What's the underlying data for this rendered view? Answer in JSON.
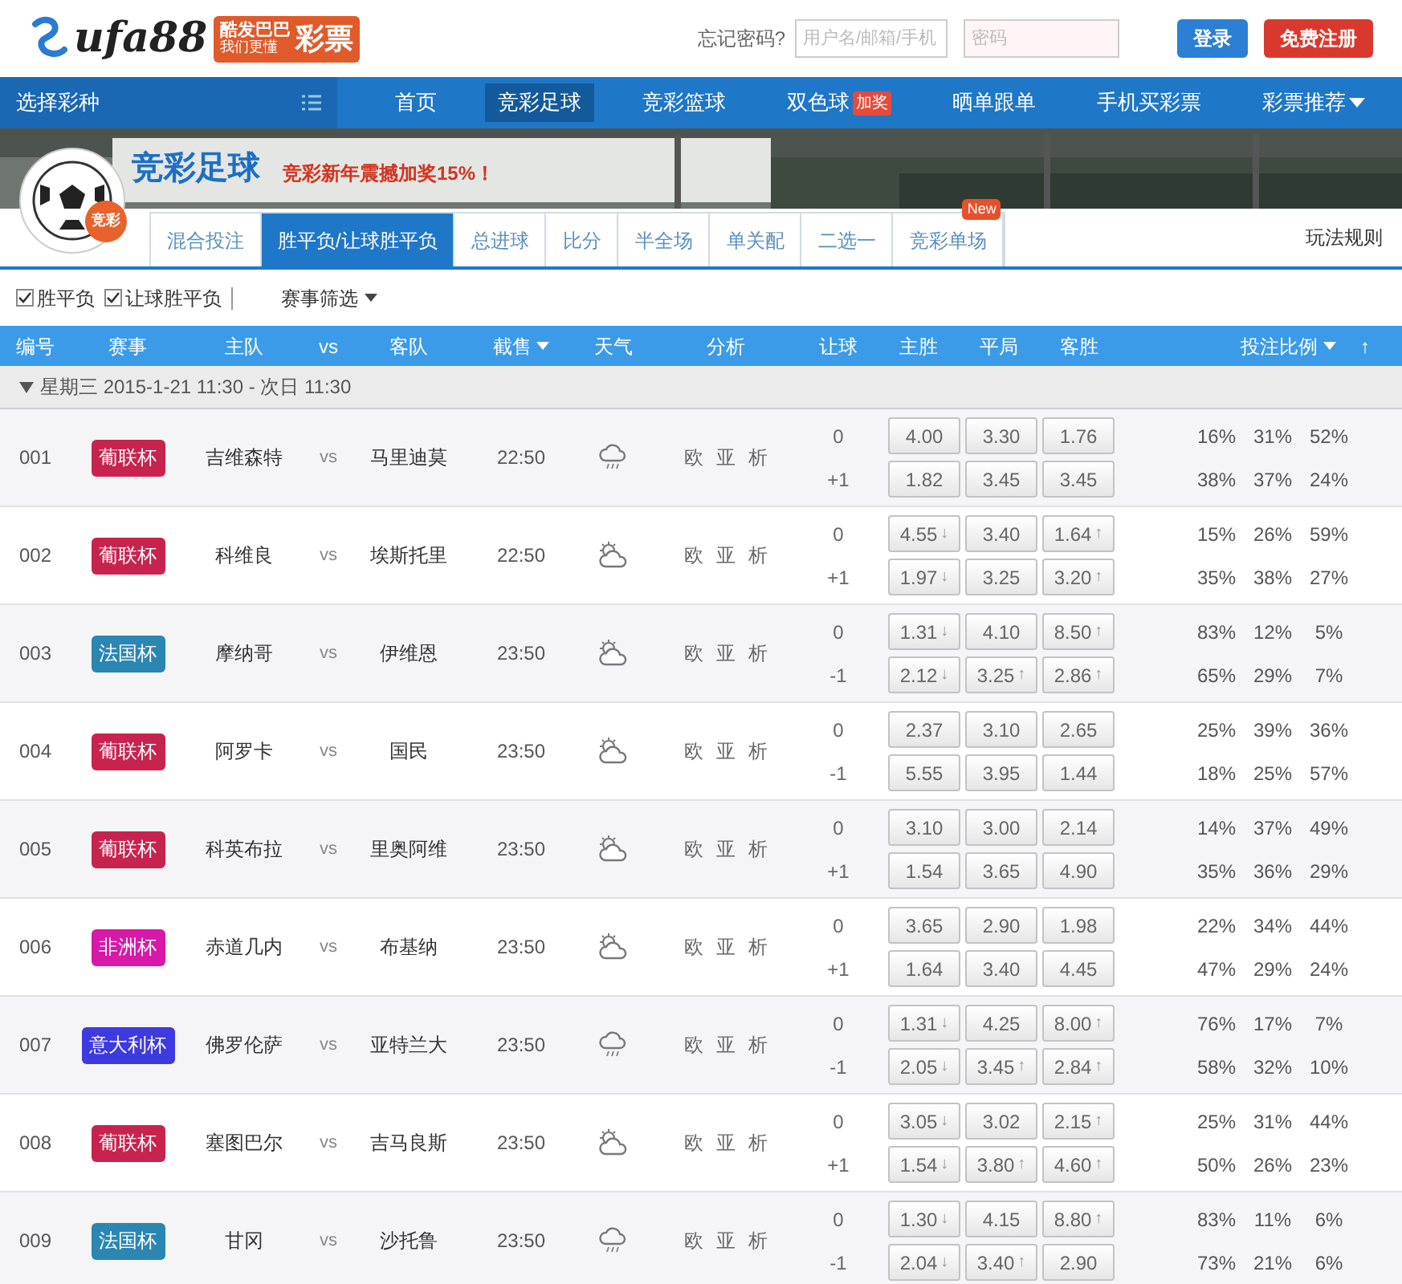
{
  "header": {
    "logo": {
      "brand": "ufa88",
      "slogan_1": "酷发巴巴",
      "slogan_2": "我们更懂",
      "slogan_3": "彩票"
    },
    "forgot": "忘记密码?",
    "username": {
      "placeholder": "用户名/邮箱/手机"
    },
    "password": {
      "placeholder": "密码"
    },
    "login": "登录",
    "register": "免费注册"
  },
  "nav": {
    "picker": "选择彩种",
    "items": [
      {
        "label": "首页",
        "selected": false
      },
      {
        "label": "竞彩足球",
        "selected": true
      },
      {
        "label": "竞彩篮球",
        "selected": false
      },
      {
        "label": "双色球",
        "selected": false,
        "badge": "加奖"
      },
      {
        "label": "晒单跟单",
        "selected": false
      },
      {
        "label": "手机买彩票",
        "selected": false
      },
      {
        "label": "彩票推荐",
        "selected": false,
        "dropdown": true
      }
    ]
  },
  "banner": {
    "title": "竞彩足球",
    "promo": "竞彩新年震撼加奖15%！",
    "emblem": "竞彩"
  },
  "tabs": [
    {
      "label": "混合投注",
      "selected": false
    },
    {
      "label": "胜平负/让球胜平负",
      "selected": true
    },
    {
      "label": "总进球",
      "selected": false
    },
    {
      "label": "比分",
      "selected": false
    },
    {
      "label": "半全场",
      "selected": false
    },
    {
      "label": "单关配",
      "selected": false
    },
    {
      "label": "二选一",
      "selected": false
    },
    {
      "label": "竞彩单场",
      "selected": false,
      "badge": "New"
    }
  ],
  "rules_link": "玩法规则",
  "filters": [
    {
      "label": "胜平负",
      "checked": true
    },
    {
      "label": "让球胜平负",
      "checked": true
    }
  ],
  "match_filter": "赛事筛选",
  "table": {
    "columns": [
      {
        "label": "编号",
        "sortable": false
      },
      {
        "label": "赛事",
        "sortable": false
      },
      {
        "label": "主队",
        "sortable": false
      },
      {
        "label": "vs",
        "sortable": false
      },
      {
        "label": "客队",
        "sortable": false
      },
      {
        "label": "截售",
        "sortable": true
      },
      {
        "label": "天气",
        "sortable": false
      },
      {
        "label": "分析",
        "sortable": false
      },
      {
        "label": "让球",
        "sortable": false
      },
      {
        "label": "主胜",
        "sortable": false
      },
      {
        "label": "平局",
        "sortable": false
      },
      {
        "label": "客胜",
        "sortable": false
      },
      {
        "label": "投注比例",
        "sortable": true
      }
    ],
    "top": "↑",
    "group": "星期三 2015-1-21 11:30 - 次日 11:30",
    "rows": [
      {
        "no": "001",
        "league": "葡联杯",
        "color": "#c8234e",
        "home": "吉维森特",
        "vs": "vs",
        "away": "马里迪莫",
        "time": "22:50",
        "weather": {
          "kind": "rain"
        },
        "links": [
          "欧",
          "亚",
          "析"
        ],
        "lines": [
          {
            "handicap": "0",
            "odds": [
              {
                "value": "4.00"
              },
              {
                "value": "3.30"
              },
              {
                "value": "1.76"
              }
            ],
            "pct": [
              "16%",
              "31%",
              "52%"
            ]
          },
          {
            "handicap": "+1",
            "odds": [
              {
                "value": "1.82"
              },
              {
                "value": "3.45"
              },
              {
                "value": "3.45"
              }
            ],
            "pct": [
              "38%",
              "37%",
              "24%"
            ]
          }
        ]
      },
      {
        "no": "002",
        "league": "葡联杯",
        "color": "#c8234e",
        "home": "科维良",
        "vs": "vs",
        "away": "埃斯托里",
        "time": "22:50",
        "weather": {
          "kind": "partly_cloudy"
        },
        "links": [
          "欧",
          "亚",
          "析"
        ],
        "lines": [
          {
            "handicap": "0",
            "odds": [
              {
                "value": "4.55",
                "arrow": "↓"
              },
              {
                "value": "3.40"
              },
              {
                "value": "1.64",
                "arrow": "↑"
              }
            ],
            "pct": [
              "15%",
              "26%",
              "59%"
            ]
          },
          {
            "handicap": "+1",
            "odds": [
              {
                "value": "1.97",
                "arrow": "↓"
              },
              {
                "value": "3.25"
              },
              {
                "value": "3.20",
                "arrow": "↑"
              }
            ],
            "pct": [
              "35%",
              "38%",
              "27%"
            ]
          }
        ]
      },
      {
        "no": "003",
        "league": "法国杯",
        "color": "#2b86b3",
        "home": "摩纳哥",
        "vs": "vs",
        "away": "伊维恩",
        "time": "23:50",
        "weather": {
          "kind": "partly_cloudy"
        },
        "links": [
          "欧",
          "亚",
          "析"
        ],
        "lines": [
          {
            "handicap": "0",
            "odds": [
              {
                "value": "1.31",
                "arrow": "↓"
              },
              {
                "value": "4.10"
              },
              {
                "value": "8.50",
                "arrow": "↑"
              }
            ],
            "pct": [
              "83%",
              "12%",
              "5%"
            ]
          },
          {
            "handicap": "-1",
            "odds": [
              {
                "value": "2.12",
                "arrow": "↓"
              },
              {
                "value": "3.25",
                "arrow": "↑"
              },
              {
                "value": "2.86",
                "arrow": "↑"
              }
            ],
            "pct": [
              "65%",
              "29%",
              "7%"
            ]
          }
        ]
      },
      {
        "no": "004",
        "league": "葡联杯",
        "color": "#c8234e",
        "home": "阿罗卡",
        "vs": "vs",
        "away": "国民",
        "time": "23:50",
        "weather": {
          "kind": "partly_cloudy"
        },
        "links": [
          "欧",
          "亚",
          "析"
        ],
        "lines": [
          {
            "handicap": "0",
            "odds": [
              {
                "value": "2.37"
              },
              {
                "value": "3.10"
              },
              {
                "value": "2.65"
              }
            ],
            "pct": [
              "25%",
              "39%",
              "36%"
            ]
          },
          {
            "handicap": "-1",
            "odds": [
              {
                "value": "5.55"
              },
              {
                "value": "3.95"
              },
              {
                "value": "1.44"
              }
            ],
            "pct": [
              "18%",
              "25%",
              "57%"
            ]
          }
        ]
      },
      {
        "no": "005",
        "league": "葡联杯",
        "color": "#c8234e",
        "home": "科英布拉",
        "vs": "vs",
        "away": "里奥阿维",
        "time": "23:50",
        "weather": {
          "kind": "partly_cloudy"
        },
        "links": [
          "欧",
          "亚",
          "析"
        ],
        "lines": [
          {
            "handicap": "0",
            "odds": [
              {
                "value": "3.10"
              },
              {
                "value": "3.00"
              },
              {
                "value": "2.14"
              }
            ],
            "pct": [
              "14%",
              "37%",
              "49%"
            ]
          },
          {
            "handicap": "+1",
            "odds": [
              {
                "value": "1.54"
              },
              {
                "value": "3.65"
              },
              {
                "value": "4.90"
              }
            ],
            "pct": [
              "35%",
              "36%",
              "29%"
            ]
          }
        ]
      },
      {
        "no": "006",
        "league": "非洲杯",
        "color": "#d917a8",
        "home": "赤道几内",
        "vs": "vs",
        "away": "布基纳",
        "time": "23:50",
        "weather": {
          "kind": "partly_cloudy"
        },
        "links": [
          "欧",
          "亚",
          "析"
        ],
        "lines": [
          {
            "handicap": "0",
            "odds": [
              {
                "value": "3.65"
              },
              {
                "value": "2.90"
              },
              {
                "value": "1.98"
              }
            ],
            "pct": [
              "22%",
              "34%",
              "44%"
            ]
          },
          {
            "handicap": "+1",
            "odds": [
              {
                "value": "1.64"
              },
              {
                "value": "3.40"
              },
              {
                "value": "4.45"
              }
            ],
            "pct": [
              "47%",
              "29%",
              "24%"
            ]
          }
        ]
      },
      {
        "no": "007",
        "league": "意大利杯",
        "color": "#3d3ae0",
        "home": "佛罗伦萨",
        "vs": "vs",
        "away": "亚特兰大",
        "time": "23:50",
        "weather": {
          "kind": "rain"
        },
        "links": [
          "欧",
          "亚",
          "析"
        ],
        "lines": [
          {
            "handicap": "0",
            "odds": [
              {
                "value": "1.31",
                "arrow": "↓"
              },
              {
                "value": "4.25"
              },
              {
                "value": "8.00",
                "arrow": "↑"
              }
            ],
            "pct": [
              "76%",
              "17%",
              "7%"
            ]
          },
          {
            "handicap": "-1",
            "odds": [
              {
                "value": "2.05",
                "arrow": "↓"
              },
              {
                "value": "3.45",
                "arrow": "↑"
              },
              {
                "value": "2.84",
                "arrow": "↑"
              }
            ],
            "pct": [
              "58%",
              "32%",
              "10%"
            ]
          }
        ]
      },
      {
        "no": "008",
        "league": "葡联杯",
        "color": "#c8234e",
        "home": "塞图巴尔",
        "vs": "vs",
        "away": "吉马良斯",
        "time": "23:50",
        "weather": {
          "kind": "partly_cloudy"
        },
        "links": [
          "欧",
          "亚",
          "析"
        ],
        "lines": [
          {
            "handicap": "0",
            "odds": [
              {
                "value": "3.05",
                "arrow": "↓"
              },
              {
                "value": "3.02"
              },
              {
                "value": "2.15",
                "arrow": "↑"
              }
            ],
            "pct": [
              "25%",
              "31%",
              "44%"
            ]
          },
          {
            "handicap": "+1",
            "odds": [
              {
                "value": "1.54",
                "arrow": "↓"
              },
              {
                "value": "3.80",
                "arrow": "↑"
              },
              {
                "value": "4.60",
                "arrow": "↑"
              }
            ],
            "pct": [
              "50%",
              "26%",
              "23%"
            ]
          }
        ]
      },
      {
        "no": "009",
        "league": "法国杯",
        "color": "#2b86b3",
        "home": "甘冈",
        "vs": "vs",
        "away": "沙托鲁",
        "time": "23:50",
        "weather": {
          "kind": "rain"
        },
        "links": [
          "欧",
          "亚",
          "析"
        ],
        "lines": [
          {
            "handicap": "0",
            "odds": [
              {
                "value": "1.30",
                "arrow": "↓"
              },
              {
                "value": "4.15"
              },
              {
                "value": "8.80",
                "arrow": "↑"
              }
            ],
            "pct": [
              "83%",
              "11%",
              "6%"
            ]
          },
          {
            "handicap": "-1",
            "odds": [
              {
                "value": "2.04",
                "arrow": "↓"
              },
              {
                "value": "3.40",
                "arrow": "↑"
              },
              {
                "value": "2.90"
              }
            ],
            "pct": [
              "73%",
              "21%",
              "6%"
            ]
          }
        ]
      }
    ]
  }
}
